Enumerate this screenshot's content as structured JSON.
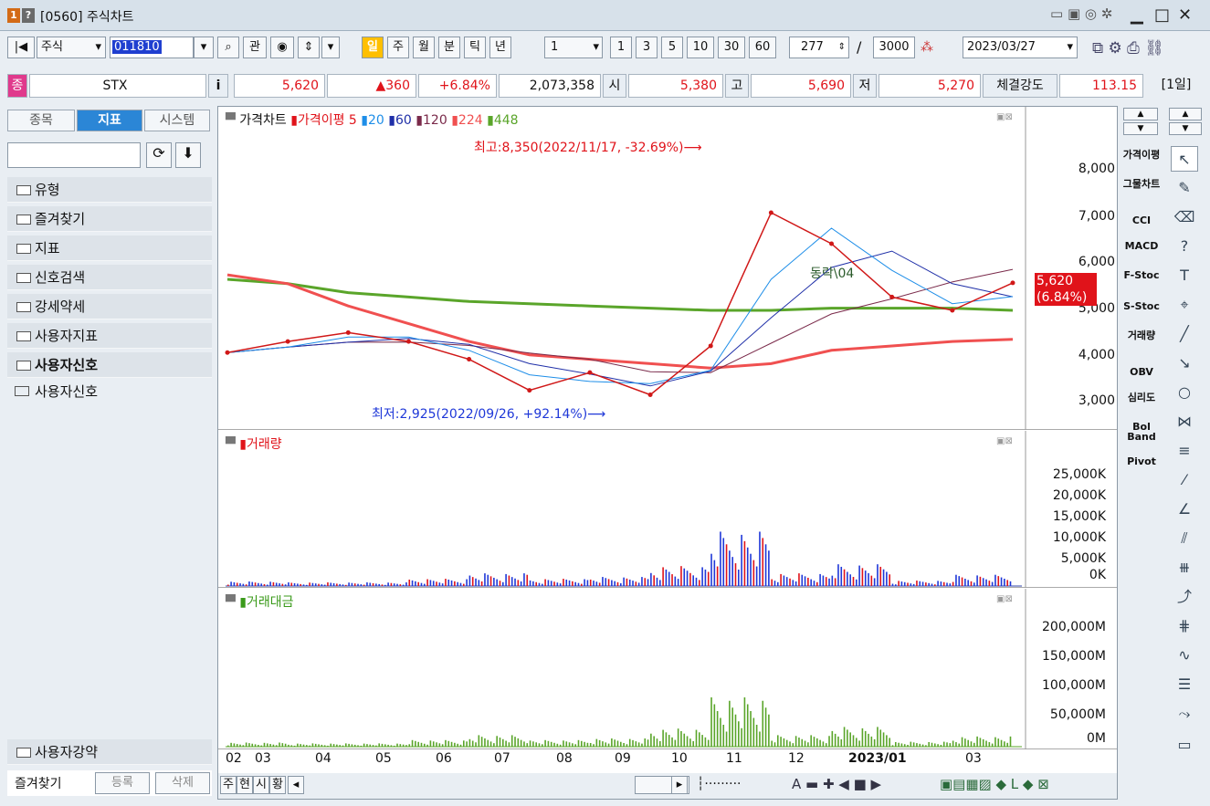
{
  "title": {
    "num1": "1",
    "num2": "?",
    "text": "[0560] 주식차트"
  },
  "toolbar": {
    "market": "주식",
    "code": "011810",
    "btn_gwan": "관",
    "period": [
      "일",
      "주",
      "월",
      "분",
      "틱",
      "년"
    ],
    "unit_value": "1",
    "presets": [
      "1",
      "3",
      "5",
      "10",
      "30",
      "60"
    ],
    "count": "277",
    "slash": "/",
    "total": "3000",
    "date": "2023/03/27"
  },
  "info": {
    "badge": "종",
    "name": "STX",
    "i": "i",
    "price": "5,620",
    "change": "▲360",
    "rate": "+6.84%",
    "volume": "2,073,358",
    "open_label": "시",
    "open": "5,380",
    "high_label": "고",
    "high": "5,690",
    "low_label": "저",
    "low": "5,270",
    "strength_label": "체결강도",
    "strength": "113.15",
    "period_label": "[1일]"
  },
  "left": {
    "tabs": [
      "종목",
      "지표",
      "시스템"
    ],
    "items": [
      "유형",
      "즐겨찾기",
      "지표",
      "신호검색",
      "강세약세",
      "사용자지표",
      "사용자신호"
    ],
    "subitem": "사용자신호",
    "bottom_item": "사용자강약",
    "footer": [
      "즐겨찾기",
      "등록",
      "삭제"
    ]
  },
  "chart": {
    "legend_title": "가격차트",
    "legend_ma": "가격이평",
    "ma_periods": [
      "5",
      "20",
      "60",
      "120",
      "224",
      "448"
    ],
    "high_note": "최고:8,350(2022/11/17, -32.69%)⟶",
    "low_note": "최저:2,925(2022/09/26, +92.14%)⟶",
    "signal_text": "동락\\04",
    "price_ticks": [
      "8,000",
      "7,000",
      "6,000",
      "5,000",
      "4,000",
      "3,000"
    ],
    "current_price": "5,620",
    "current_rate": "(6.84%)",
    "vol_title": "거래량",
    "vol_ticks": [
      "25,000K",
      "20,000K",
      "15,000K",
      "10,000K",
      "5,000K",
      "0K"
    ],
    "amt_title": "거래대금",
    "amt_ticks": [
      "200,000M",
      "150,000M",
      "100,000M",
      "50,000M",
      "0M"
    ],
    "x_ticks": [
      "02",
      "03",
      "04",
      "05",
      "06",
      "07",
      "08",
      "09",
      "10",
      "11",
      "12",
      "2023/01",
      "03"
    ],
    "bottom_btns": [
      "주",
      "현",
      "시",
      "황"
    ],
    "colors": {
      "ma5": "#e0131a",
      "ma20": "#1e8ee8",
      "ma60": "#1f2fa8",
      "ma120": "#7a2a4a",
      "ma224": "#f05050",
      "ma448": "#5aa52a"
    }
  },
  "right": {
    "indicators": [
      "가격이평",
      "그물차트",
      "CCI",
      "MACD",
      "F-Stoc",
      "S-Stoc",
      "거래량",
      "OBV",
      "심리도",
      "Bol Band",
      "Pivot"
    ]
  },
  "chart_data": {
    "type": "line",
    "title": "가격차트",
    "x": [
      "2022/02",
      "2022/03",
      "2022/04",
      "2022/05",
      "2022/06",
      "2022/07",
      "2022/08",
      "2022/09",
      "2022/10",
      "2022/11",
      "2022/12",
      "2023/01",
      "2023/02",
      "2023/03"
    ],
    "series": [
      {
        "name": "가격",
        "values": [
          4050,
          4300,
          4500,
          4300,
          3900,
          3200,
          3600,
          3100,
          4200,
          7200,
          6500,
          5300,
          5000,
          5620
        ]
      },
      {
        "name": "448",
        "values": [
          5700,
          5600,
          5400,
          5300,
          5200,
          5150,
          5100,
          5050,
          5000,
          5000,
          5050,
          5050,
          5050,
          5000
        ]
      },
      {
        "name": "224",
        "values": [
          5800,
          5600,
          5100,
          4700,
          4300,
          4000,
          3900,
          3800,
          3700,
          3800,
          4100,
          4200,
          4300,
          4350
        ]
      }
    ],
    "ylim": [
      2500,
      8500
    ],
    "high": {
      "value": 8350,
      "date": "2022/11/17",
      "rate": "-32.69%"
    },
    "low": {
      "value": 2925,
      "date": "2022/09/26",
      "rate": "+92.14%"
    }
  }
}
